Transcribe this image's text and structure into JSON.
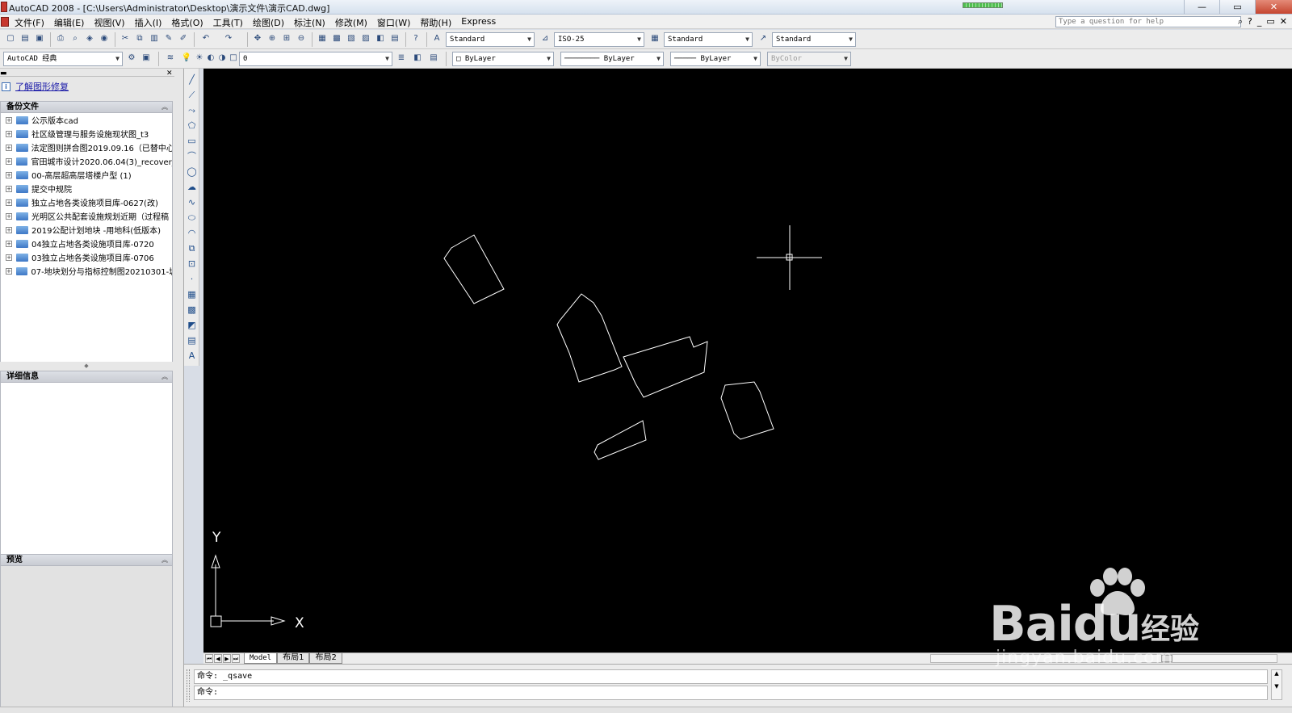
{
  "window": {
    "title": "AutoCAD 2008 - [C:\\Users\\Administrator\\Desktop\\演示文件\\演示CAD.dwg]",
    "min_label": "—",
    "max_label": "▭",
    "close_label": "✕"
  },
  "menubar": {
    "items": [
      "文件(F)",
      "编辑(E)",
      "视图(V)",
      "插入(I)",
      "格式(O)",
      "工具(T)",
      "绘图(D)",
      "标注(N)",
      "修改(M)",
      "窗口(W)",
      "帮助(H)",
      "Express"
    ],
    "help_placeholder": "Type a question for help"
  },
  "toolbar1": {
    "text_style": "Standard",
    "dim_style": "ISO-25",
    "table_style": "Standard",
    "multileader_style": "Standard"
  },
  "toolbar2": {
    "workspace": "AutoCAD 经典",
    "layer": "0",
    "color": "ByLayer",
    "linetype": "ByLayer",
    "lineweight": "ByLayer",
    "plotstyle": "ByColor"
  },
  "palette": {
    "recover_link": "了解图形修复",
    "backup_header": "备份文件",
    "details_header": "详细信息",
    "preview_header": "预览",
    "files": [
      "公示版本cad",
      "社区级管理与服务设施现状图_t3",
      "法定图则拼合图2019.09.16（已替中心",
      "官田城市设计2020.06.04(3)_recover_",
      "00-高层超高层塔楼户型 (1)",
      "提交中规院",
      "独立占地各类设施项目库-0627(改)",
      "光明区公共配套设施规划近期（过程稿",
      "2019公配计划地块 -用地科(低版本)",
      "04独立占地各类设施项目库-0720",
      "03独立占地各类设施项目库-0706",
      "07-地块划分与指标控制图20210301-城"
    ]
  },
  "canvas": {
    "ucs_x_label": "X",
    "ucs_y_label": "Y"
  },
  "layout_tabs": [
    "Model",
    "布局1",
    "布局2"
  ],
  "command": {
    "history": "命令: _qsave",
    "prompt": "命令:"
  },
  "watermark": {
    "brand": "Bai",
    "brand_du": "du",
    "brand_cn": "经验",
    "site": "jingyan.baidu.com"
  }
}
